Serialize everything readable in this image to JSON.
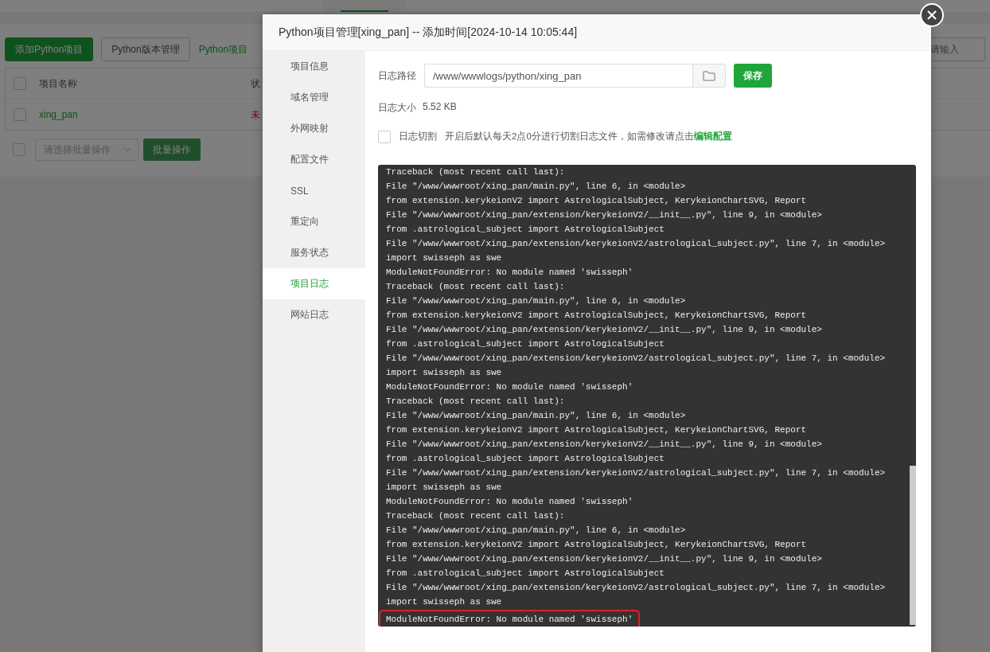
{
  "background": {
    "toolbar": {
      "buttons": [
        {
          "label": "添加Python项目",
          "kind": "primary"
        },
        {
          "label": "Python版本管理",
          "kind": "default"
        },
        {
          "label": "Python项目",
          "kind": "link"
        }
      ],
      "search_placeholder": "请输入"
    },
    "table": {
      "all_checked": false,
      "columns": [
        "项目名称",
        "状"
      ],
      "rows": [
        {
          "name": "xing_pan",
          "status": "未",
          "checked": false
        }
      ]
    },
    "bulk": {
      "checked": false,
      "select_placeholder": "请选择批量操作",
      "button": "批量操作"
    }
  },
  "dialog": {
    "title": "Python项目管理[xing_pan] -- 添加时间[2024-10-14 10:05:44]",
    "sidebar": [
      {
        "label": "项目信息",
        "selected": false
      },
      {
        "label": "域名管理",
        "selected": false
      },
      {
        "label": "外网映射",
        "selected": false
      },
      {
        "label": "配置文件",
        "selected": false
      },
      {
        "label": "SSL",
        "selected": false
      },
      {
        "label": "重定向",
        "selected": false
      },
      {
        "label": "服务状态",
        "selected": false
      },
      {
        "label": "项目日志",
        "selected": true
      },
      {
        "label": "网站日志",
        "selected": false
      }
    ],
    "log_path": {
      "label": "日志路径",
      "value": "/www/wwwlogs/python/xing_pan",
      "save": "保存"
    },
    "log_size": {
      "label": "日志大小",
      "value": "5.52 KB"
    },
    "log_rotate": {
      "label": "日志切割",
      "checked": false,
      "description": "开启后默认每天2点0分进行切割日志文件，如需修改请点击",
      "link": "编辑配置"
    },
    "log_lines": [
      {
        "text": "Traceback (most recent call last):",
        "highlighted": false
      },
      {
        "text": "File \"/www/wwwroot/xing_pan/main.py\", line 6, in <module>",
        "highlighted": false
      },
      {
        "text": "from extension.kerykeionV2 import AstrologicalSubject, KerykeionChartSVG, Report",
        "highlighted": false
      },
      {
        "text": "File \"/www/wwwroot/xing_pan/extension/kerykeionV2/__init__.py\", line 9, in <module>",
        "highlighted": false
      },
      {
        "text": "from .astrological_subject import AstrologicalSubject",
        "highlighted": false
      },
      {
        "text": "File \"/www/wwwroot/xing_pan/extension/kerykeionV2/astrological_subject.py\", line 7, in <module>",
        "highlighted": false
      },
      {
        "text": "import swisseph as swe",
        "highlighted": false
      },
      {
        "text": "ModuleNotFoundError: No module named 'swisseph'",
        "highlighted": false
      },
      {
        "text": "Traceback (most recent call last):",
        "highlighted": false
      },
      {
        "text": "File \"/www/wwwroot/xing_pan/main.py\", line 6, in <module>",
        "highlighted": false
      },
      {
        "text": "from extension.kerykeionV2 import AstrologicalSubject, KerykeionChartSVG, Report",
        "highlighted": false
      },
      {
        "text": "File \"/www/wwwroot/xing_pan/extension/kerykeionV2/__init__.py\", line 9, in <module>",
        "highlighted": false
      },
      {
        "text": "from .astrological_subject import AstrologicalSubject",
        "highlighted": false
      },
      {
        "text": "File \"/www/wwwroot/xing_pan/extension/kerykeionV2/astrological_subject.py\", line 7, in <module>",
        "highlighted": false
      },
      {
        "text": "import swisseph as swe",
        "highlighted": false
      },
      {
        "text": "ModuleNotFoundError: No module named 'swisseph'",
        "highlighted": false
      },
      {
        "text": "Traceback (most recent call last):",
        "highlighted": false
      },
      {
        "text": "File \"/www/wwwroot/xing_pan/main.py\", line 6, in <module>",
        "highlighted": false
      },
      {
        "text": "from extension.kerykeionV2 import AstrologicalSubject, KerykeionChartSVG, Report",
        "highlighted": false
      },
      {
        "text": "File \"/www/wwwroot/xing_pan/extension/kerykeionV2/__init__.py\", line 9, in <module>",
        "highlighted": false
      },
      {
        "text": "from .astrological_subject import AstrologicalSubject",
        "highlighted": false
      },
      {
        "text": "File \"/www/wwwroot/xing_pan/extension/kerykeionV2/astrological_subject.py\", line 7, in <module>",
        "highlighted": false
      },
      {
        "text": "import swisseph as swe",
        "highlighted": false
      },
      {
        "text": "ModuleNotFoundError: No module named 'swisseph'",
        "highlighted": false
      },
      {
        "text": "Traceback (most recent call last):",
        "highlighted": false
      },
      {
        "text": "File \"/www/wwwroot/xing_pan/main.py\", line 6, in <module>",
        "highlighted": false
      },
      {
        "text": "from extension.kerykeionV2 import AstrologicalSubject, KerykeionChartSVG, Report",
        "highlighted": false
      },
      {
        "text": "File \"/www/wwwroot/xing_pan/extension/kerykeionV2/__init__.py\", line 9, in <module>",
        "highlighted": false
      },
      {
        "text": "from .astrological_subject import AstrologicalSubject",
        "highlighted": false
      },
      {
        "text": "File \"/www/wwwroot/xing_pan/extension/kerykeionV2/astrological_subject.py\", line 7, in <module>",
        "highlighted": false
      },
      {
        "text": "import swisseph as swe",
        "highlighted": false
      },
      {
        "text": "ModuleNotFoundError: No module named 'swisseph'",
        "highlighted": true
      }
    ]
  }
}
